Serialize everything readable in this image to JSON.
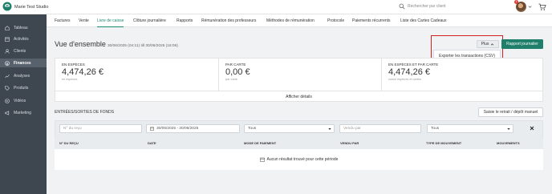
{
  "topbar": {
    "studio_name": "Marie Test Studio",
    "search_placeholder": "Rechercher par client",
    "notification_count": "1"
  },
  "sidebar": {
    "items": [
      {
        "label": "Tableau",
        "icon": "home-icon"
      },
      {
        "label": "Activités",
        "icon": "activity-icon"
      },
      {
        "label": "Clients",
        "icon": "user-icon"
      },
      {
        "label": "Finances",
        "icon": "finance-icon"
      },
      {
        "label": "Analyses",
        "icon": "chart-icon"
      },
      {
        "label": "Produits",
        "icon": "tag-icon"
      },
      {
        "label": "Vidéos",
        "icon": "video-icon"
      },
      {
        "label": "Marketing",
        "icon": "megaphone-icon"
      }
    ],
    "active_index": 3
  },
  "subnav": {
    "tabs": [
      "Factures",
      "Vente",
      "Livre de caisse",
      "Clôture journalière",
      "Rapports",
      "Rémunération des professeurs",
      "Méthodes de rémunération",
      "Protocole",
      "Paiements récurrents",
      "Liste des Cartes Cadeaux"
    ],
    "active_index": 2
  },
  "header": {
    "title": "Vue d'ensemble",
    "range": "30/06/2025 (04:11) till 30/06/2025 (18:06)",
    "plus_label": "Plus",
    "dropdown_item": "Exporter les transactions (CSV)",
    "report_button": "Rapport journalier"
  },
  "summary": {
    "columns": [
      {
        "label": "EN ESPÈCES",
        "value": "4,474,26 €",
        "sub": "en espèces"
      },
      {
        "label": "PAR CARTE",
        "value": "0,00 €",
        "sub": "par carte"
      },
      {
        "label": "EN ESPÈCES ET PAR CARTE",
        "value": "4,474,26 €",
        "sub": "cumul espèces et cartes"
      }
    ],
    "details_label": "Afficher détails"
  },
  "funds": {
    "title": "ENTRÉES/SORTIES DE FONDS",
    "retrait_button": "Saisie le retrait / dépôt manuel",
    "filters": {
      "receipt_placeholder": "N° du reçu",
      "date_range": "30/06/2025 - 30/06/2025",
      "mode_value": "Tous",
      "sold_by_placeholder": "Vendu par",
      "type_value": "Tous"
    },
    "columns": [
      "N° DU REÇU",
      "DATE",
      "MODE DE PAIEMENT",
      "VENDU PAR",
      "TYPE DE MOUVEMENT",
      "MOUVEMENTS"
    ],
    "empty_message": "Aucun résultat trouvé pour cette période"
  },
  "colors": {
    "accent": "#1f7f6b",
    "sidebar_bg": "#3e4750",
    "highlight_frame": "#d42020"
  }
}
